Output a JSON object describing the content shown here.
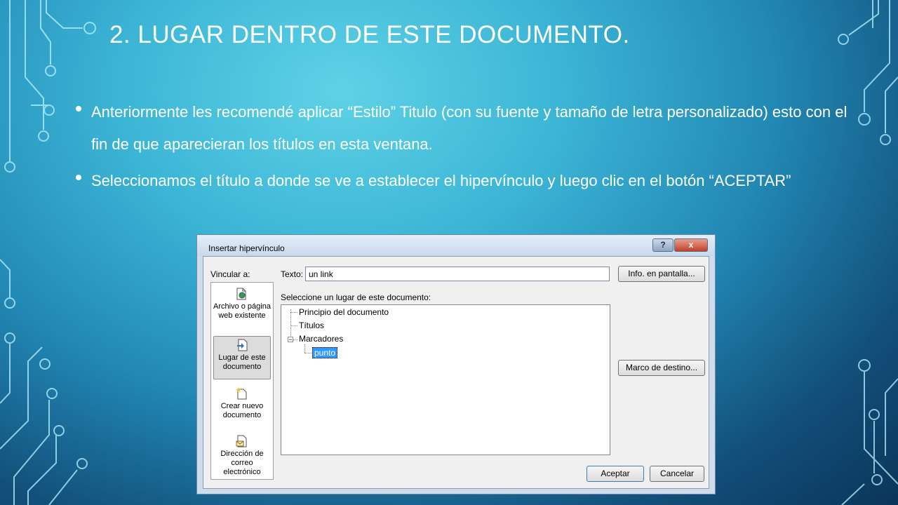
{
  "slide": {
    "title": "2. LUGAR DENTRO DE ESTE DOCUMENTO.",
    "bullets": [
      "Anteriormente les recomendé aplicar “Estilo” Titulo (con su fuente y tamaño de letra personalizado) esto con el fin de que aparecieran los títulos en esta ventana.",
      "Seleccionamos el título a donde se ve a establecer el hipervínculo y luego clic en el botón “ACEPTAR”"
    ]
  },
  "dialog": {
    "title": "Insertar hipervínculo",
    "help_label": "?",
    "close_label": "x",
    "vincular_label": "Vincular a:",
    "places": [
      {
        "label": "Archivo o página web existente",
        "icon": "web-page-icon"
      },
      {
        "label": "Lugar de este documento",
        "icon": "place-in-document-icon",
        "selected": true
      },
      {
        "label": "Crear nuevo documento",
        "icon": "new-document-icon"
      },
      {
        "label": "Dirección de correo electrónico",
        "icon": "email-icon"
      }
    ],
    "texto_label": "Texto:",
    "texto_value": "un link",
    "info_button": "Info. en pantalla...",
    "select_label": "Seleccione un lugar de este documento:",
    "tree": {
      "inicio": "Principio del documento",
      "titulos": "Títulos",
      "marcadores": "Marcadores",
      "punto": "punto",
      "expander": "−"
    },
    "marco_button": "Marco de destino...",
    "aceptar_button": "Aceptar",
    "cancelar_button": "Cancelar"
  },
  "colors": {
    "background_light": "#5ed2e6",
    "background_dark": "#0b3559",
    "selection": "#3399ff"
  }
}
